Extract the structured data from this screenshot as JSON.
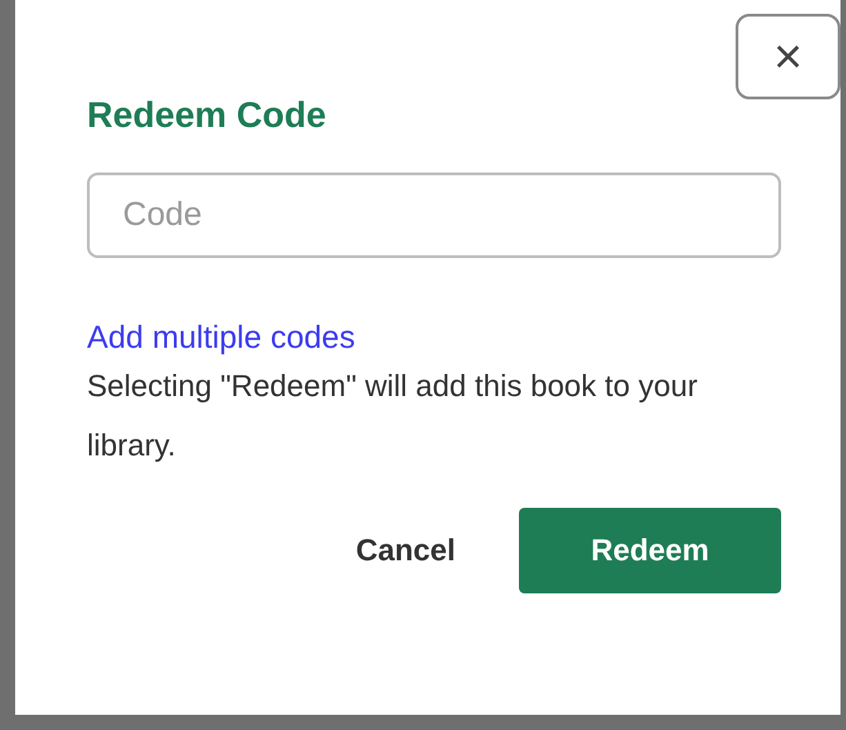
{
  "dialog": {
    "close": "×",
    "title": "Redeem Code",
    "code_field": {
      "placeholder": "Code"
    },
    "link": "Add multiple codes",
    "message": "Selecting \"Redeem\" will add this book to your library.",
    "buttons": [
      {
        "label": "Cancel",
        "kind": "text"
      },
      {
        "label": "Redeem",
        "kind": "primary"
      }
    ]
  }
}
